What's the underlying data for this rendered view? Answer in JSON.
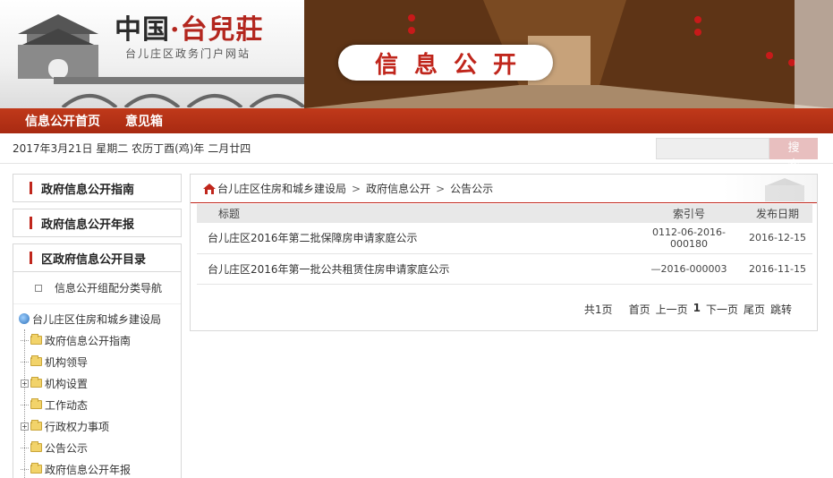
{
  "header": {
    "logo_title_part1": "中国",
    "logo_dot": "·",
    "logo_title_part2": "台兒莊",
    "logo_subtitle": "台儿庄区政务门户网站",
    "section_seal": "信息公开"
  },
  "nav": {
    "items": [
      {
        "label": "信息公开首页"
      },
      {
        "label": "意见箱"
      }
    ]
  },
  "infobar": {
    "date_text": "2017年3月21日  星期二  农历丁酉(鸡)年  二月廿四",
    "search_placeholder": "",
    "search_button": "搜 索"
  },
  "sidebar": {
    "boxes": [
      {
        "label": "政府信息公开指南"
      },
      {
        "label": "政府信息公开年报"
      }
    ],
    "tree_title": "区政府信息公开目录",
    "nav_guide": "信息公开组配分类导航",
    "tree_root": "台儿庄区住房和城乡建设局",
    "tree_items": [
      {
        "label": "政府信息公开指南",
        "expandable": false
      },
      {
        "label": "机构领导",
        "expandable": false
      },
      {
        "label": "机构设置",
        "expandable": true
      },
      {
        "label": "工作动态",
        "expandable": false
      },
      {
        "label": "行政权力事项",
        "expandable": true
      },
      {
        "label": "公告公示",
        "expandable": false
      },
      {
        "label": "政府信息公开年报",
        "expandable": false
      }
    ]
  },
  "content": {
    "breadcrumb": [
      "台儿庄区住房和城乡建设局",
      "政府信息公开",
      "公告公示"
    ],
    "breadcrumb_sep": ">",
    "table": {
      "headers": [
        "标题",
        "索引号",
        "发布日期"
      ],
      "rows": [
        {
          "title": "台儿庄区2016年第二批保障房申请家庭公示",
          "index": "0112-06-2016-000180",
          "date": "2016-12-15"
        },
        {
          "title": "台儿庄区2016年第一批公共租赁住房申请家庭公示",
          "index": "—2016-000003",
          "date": "2016-11-15"
        }
      ]
    },
    "pager": {
      "total": "共1页",
      "first": "首页",
      "prev": "上一页",
      "current": "1",
      "next": "下一页",
      "last": "尾页",
      "jump": "跳转"
    }
  },
  "colors": {
    "brand_red": "#c0261c",
    "nav_red": "#a82a12",
    "search_button": "#e8bfbf"
  }
}
